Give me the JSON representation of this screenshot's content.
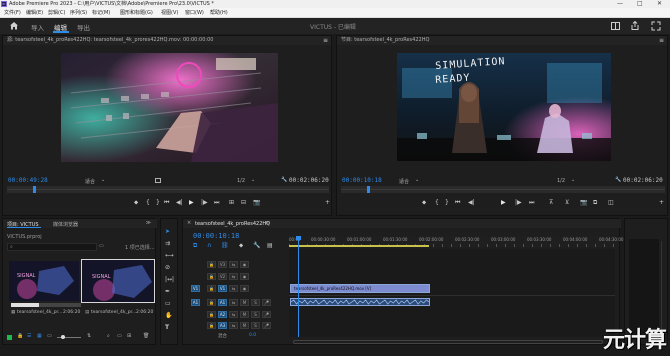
{
  "titlebar": {
    "app_icon": "Pr",
    "title": "Adobe Premiere Pro 2023 - C:\\用户\\VICTUS\\文档\\Adobe\\Premiere Pro\\23.0\\VICTUS *",
    "minimize": "—",
    "maximize": "□",
    "close": "✕"
  },
  "menubar": {
    "items": [
      "文件(F)",
      "编辑(E)",
      "剪辑(C)",
      "序列(S)",
      "标记(M)",
      "图形和标题(G)",
      "视图(V)",
      "窗口(W)",
      "帮助(H)"
    ]
  },
  "workspace": {
    "tabs": [
      "导入",
      "编辑",
      "导出"
    ],
    "active_tab": "编辑",
    "project_name": "VICTUS - 已编辑"
  },
  "source_monitor": {
    "header": "源: tearsofsteel_4k_proRes422HQ: tearsofsteel_4k_prores422HQ.mov: 00:00:00:00",
    "timecode": "00:00:49:28",
    "fit": "适合",
    "resolution": "1/2",
    "duration": "00:02:06:20",
    "playhead_fraction": 0.08
  },
  "program_monitor": {
    "header": "节目: tearsofsteel_4k_proRes422HQ",
    "timecode": "00:00:10:18",
    "fit": "适合",
    "resolution": "1/2",
    "duration": "00:02:06:20",
    "overlay_text_1": "SIMULATION",
    "overlay_text_2": "READY",
    "playhead_fraction": 0.08
  },
  "project_panel": {
    "tabs": [
      "项目: VICTUS",
      "媒体浏览器"
    ],
    "file": "VICTUS.prproj",
    "selection": "1 项已选择...",
    "items": [
      {
        "name": "tearsofsteel_4k_pr...",
        "duration": "2:06:20"
      },
      {
        "name": "tearsofsteel_4k_pr...",
        "duration": "2:06:20"
      }
    ]
  },
  "timeline": {
    "sequence_name": "tearsofsteel_4k_proRes422HQ",
    "timecode": "00:00:10:18",
    "ruler": [
      "00:00",
      "00:00:30:00",
      "00:01:00:00",
      "00:01:30:00",
      "00:02:00:00",
      "00:02:30:00",
      "00:03:00:00",
      "00:03:30:00",
      "00:04:00:00",
      "00:04:30:00"
    ],
    "video_tracks": [
      "V3",
      "V2",
      "V1"
    ],
    "audio_tracks": [
      "A1",
      "A2",
      "A3"
    ],
    "src_video": "V1",
    "src_audio": "A1",
    "mix_label": "混合",
    "mix_value": "0.0",
    "clip_name": "tearsofsteel_4k_proRes422HQ.mov [V]",
    "playhead_fraction": 0.027,
    "clip_end_fraction": 0.43
  },
  "tools": [
    "select-tool",
    "track-select-tool",
    "ripple-edit-tool",
    "razor-tool",
    "slip-tool",
    "pen-tool",
    "rectangle-tool",
    "hand-tool",
    "type-tool"
  ],
  "watermark": "元计算",
  "colors": {
    "accent": "#2d8ceb",
    "panel_bg": "#1e1e1e",
    "audio_clip": "#2c4a78",
    "video_clip": "#7d8bd0"
  }
}
